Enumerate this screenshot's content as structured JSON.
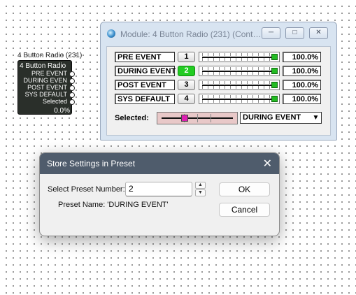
{
  "block": {
    "title": "4 Button Radio (231)",
    "header": "4 Button Radio",
    "rows": [
      "PRE EVENT",
      "DURING EVEN",
      "POST EVENT",
      "SYS DEFAULT",
      "Selected"
    ],
    "value": "0.0%"
  },
  "module": {
    "title": "Module: 4 Button Radio (231) (Cont…",
    "rows": [
      {
        "label": "PRE EVENT",
        "number": "1",
        "active": false,
        "value": "100.0%",
        "level": 1.0
      },
      {
        "label": "DURING EVENT",
        "number": "2",
        "active": true,
        "value": "100.0%",
        "level": 1.0
      },
      {
        "label": "POST EVENT",
        "number": "3",
        "active": false,
        "value": "100.0%",
        "level": 1.0
      },
      {
        "label": "SYS DEFAULT",
        "number": "4",
        "active": false,
        "value": "100.0%",
        "level": 1.0
      }
    ],
    "selected_label": "Selected:",
    "selected_value": "DURING EVENT",
    "active_color": "#22cc22"
  },
  "dialog": {
    "title": "Store Settings in Preset",
    "preset_label": "Select Preset Number:",
    "preset_value": "2",
    "preset_name": "Preset Name: 'DURING EVENT'",
    "ok": "OK",
    "cancel": "Cancel",
    "header_color": "#4f5c6c"
  }
}
